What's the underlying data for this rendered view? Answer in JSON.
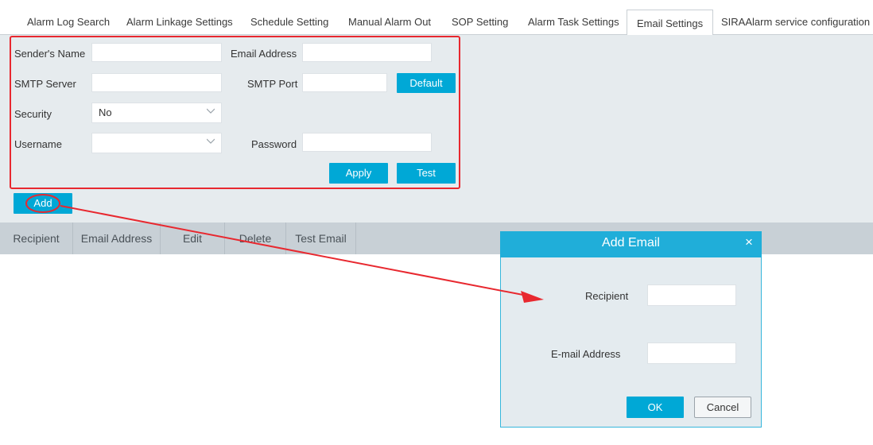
{
  "tabs": [
    {
      "label": "Alarm Log Search"
    },
    {
      "label": "Alarm Linkage Settings"
    },
    {
      "label": "Schedule Setting"
    },
    {
      "label": "Manual Alarm Out"
    },
    {
      "label": "SOP Setting"
    },
    {
      "label": "Alarm Task Settings"
    },
    {
      "label": "Email Settings",
      "active": true
    },
    {
      "label": "SIRAAlarm service configuration"
    }
  ],
  "form": {
    "sender_name_label": "Sender's Name",
    "sender_name_value": "",
    "email_address_label": "Email Address",
    "email_address_value": "",
    "smtp_server_label": "SMTP Server",
    "smtp_server_value": "",
    "smtp_port_label": "SMTP Port",
    "smtp_port_value": "",
    "default_button": "Default",
    "security_label": "Security",
    "security_value": "No",
    "username_label": "Username",
    "username_value": "",
    "password_label": "Password",
    "password_value": "",
    "apply_button": "Apply",
    "test_button": "Test"
  },
  "add_button": "Add",
  "table": {
    "columns": [
      "Recipient",
      "Email Address",
      "Edit",
      "Delete",
      "Test Email"
    ]
  },
  "dialog": {
    "title": "Add Email",
    "close_glyph": "×",
    "recipient_label": "Recipient",
    "recipient_value": "",
    "email_label": "E-mail Address",
    "email_value": "",
    "ok_button": "OK",
    "cancel_button": "Cancel"
  },
  "colors": {
    "accent": "#00a8d6",
    "annotation_red": "#e8282f",
    "panel_bg": "#e6ebee",
    "table_header_bg": "#c8d0d6"
  }
}
